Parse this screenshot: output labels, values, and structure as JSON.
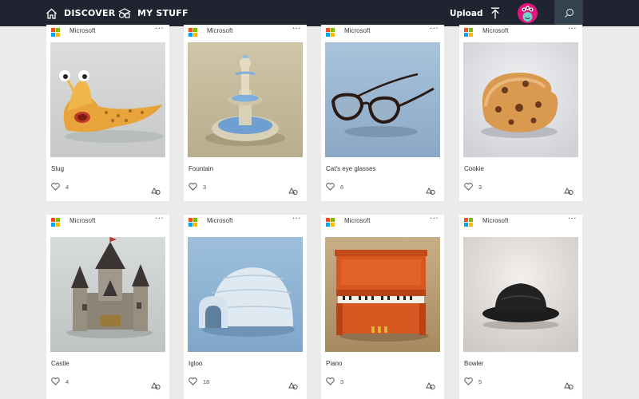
{
  "nav": {
    "discover_label": "DISCOVER",
    "mystuff_label": "MY STUFF",
    "upload_label": "Upload"
  },
  "cards": [
    {
      "publisher": "Microsoft",
      "more": "···",
      "title": "Slug",
      "likes": "4"
    },
    {
      "publisher": "Microsoft",
      "more": "···",
      "title": "Fountain",
      "likes": "3"
    },
    {
      "publisher": "Microsoft",
      "more": "···",
      "title": "Cat's eye glasses",
      "likes": "6"
    },
    {
      "publisher": "Microsoft",
      "more": "···",
      "title": "Cookie",
      "likes": "3"
    },
    {
      "publisher": "Microsoft",
      "more": "···",
      "title": "Castle",
      "likes": "4"
    },
    {
      "publisher": "Microsoft",
      "more": "···",
      "title": "Igloo",
      "likes": "18"
    },
    {
      "publisher": "Microsoft",
      "more": "···",
      "title": "Piano",
      "likes": "3"
    },
    {
      "publisher": "Microsoft",
      "more": "···",
      "title": "Bowler",
      "likes": "5"
    }
  ],
  "icons": {
    "discover": "home-icon",
    "mystuff": "shapes-icon",
    "upload": "upload-arrow-icon",
    "search": "search-icon",
    "like": "heart-icon",
    "remix": "remix-icon",
    "publisher_logo": "microsoft-logo"
  },
  "colors": {
    "topbar": "#1f2430",
    "search_button": "#34414f",
    "avatar": "#e2157e",
    "page_background": "#ebebeb",
    "card_background": "#ffffff"
  }
}
